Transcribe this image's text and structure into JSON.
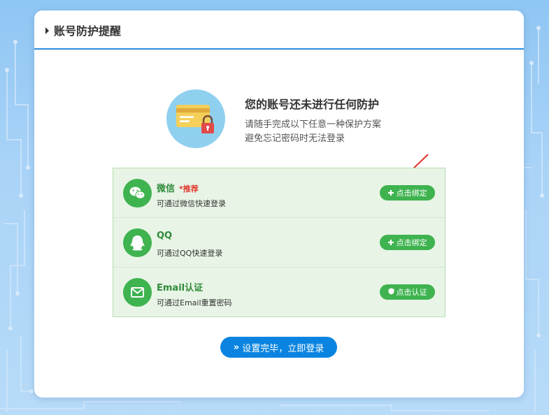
{
  "header": {
    "title": "账号防护提醒"
  },
  "hero": {
    "icon": "credit-card-lock-icon",
    "title": "您的账号还未进行任何防护",
    "line1": "请随手完成以下任意一种保护方案",
    "line2": "避免忘记密码时无法登录"
  },
  "options": [
    {
      "icon": "wechat-icon",
      "name": "微信",
      "badge": "*推荐",
      "desc": "可通过微信快速登录",
      "button_icon": "plus-icon",
      "button": "点击绑定"
    },
    {
      "icon": "qq-icon",
      "name": "QQ",
      "badge": "",
      "desc": "可通过QQ快速登录",
      "button_icon": "plus-icon",
      "button": "点击绑定"
    },
    {
      "icon": "email-icon",
      "name": "Email认证",
      "badge": "",
      "desc": "可通过Email重置密码",
      "button_icon": "shield-icon",
      "button": "点击认证"
    }
  ],
  "footer": {
    "button_icon": "double-chevron-right-icon",
    "button": "设置完毕，立即登录"
  },
  "colors": {
    "accent_green": "#3eb34f",
    "primary_blue": "#0a84e0",
    "badge_red": "#e03a2f",
    "panel_bg": "#e8f4e6"
  }
}
